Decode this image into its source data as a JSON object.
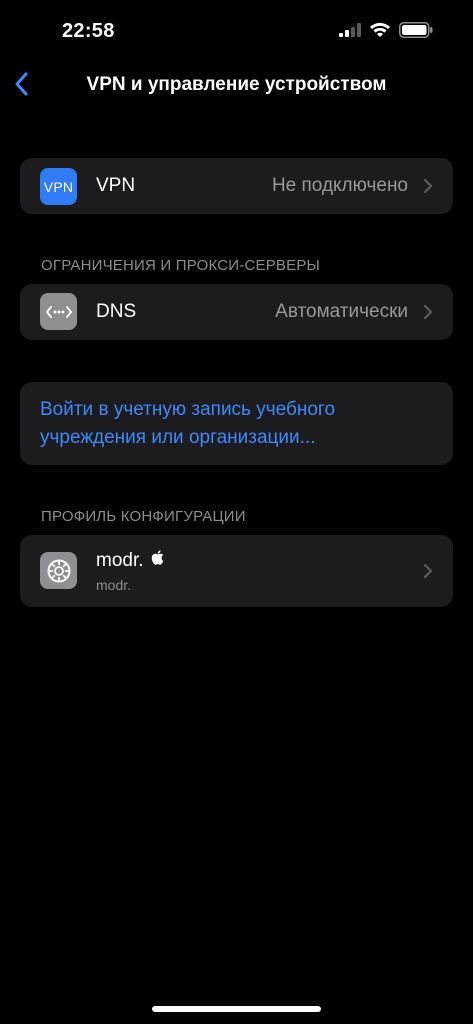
{
  "status_bar": {
    "time": "22:58",
    "icons": [
      "cellular-signal-icon",
      "wifi-icon",
      "battery-icon"
    ]
  },
  "nav": {
    "back_icon": "chevron-left-icon",
    "title": "VPN и управление устройством"
  },
  "vpn_row": {
    "icon_text": "VPN",
    "label": "VPN",
    "value": "Не подключено"
  },
  "proxy_section": {
    "header": "ОГРАНИЧЕНИЯ И ПРОКСИ-СЕРВЕРЫ",
    "dns_row": {
      "icon": "dns-icon",
      "label": "DNS",
      "value": "Автоматически"
    }
  },
  "sign_in": {
    "link": "Войти в учетную запись учебного учреждения или организации..."
  },
  "profile_section": {
    "header": "ПРОФИЛЬ КОНФИГУРАЦИИ",
    "profile": {
      "icon": "settings-gear-icon",
      "name": "modr.",
      "badge_icon": "apple-logo-icon",
      "subtitle": "modr."
    }
  },
  "colors": {
    "background": "#000000",
    "group_bg": "#1c1c1e",
    "accent_link": "#3a8bfd",
    "vpn_icon_bg": "#2f7cf6",
    "dns_icon_bg": "#8e8e93",
    "secondary_text": "#98989f"
  }
}
